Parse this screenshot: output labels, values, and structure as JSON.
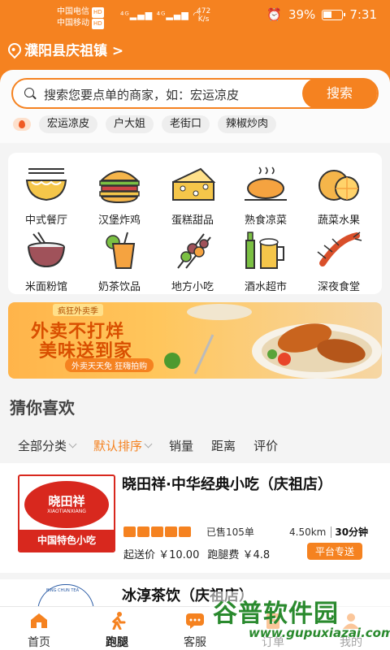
{
  "status_bar": {
    "carrier1": "中国电信",
    "carrier2": "中国移动",
    "hd": "HD",
    "speed": "472",
    "speed_unit": "K/s",
    "battery": "39%",
    "time": "7:31"
  },
  "location": {
    "text": "濮阳县庆祖镇 >"
  },
  "search": {
    "placeholder": "搜索您要点单的商家，如：宏运凉皮",
    "button": "搜索",
    "hot_tags": [
      "宏运凉皮",
      "户大姐",
      "老街口",
      "辣椒炒肉"
    ]
  },
  "categories": [
    {
      "label": "中式餐厅",
      "icon": "noodle-bowl-icon"
    },
    {
      "label": "汉堡炸鸡",
      "icon": "burger-icon"
    },
    {
      "label": "蛋糕甜品",
      "icon": "cheese-cake-icon"
    },
    {
      "label": "熟食凉菜",
      "icon": "roast-chicken-icon"
    },
    {
      "label": "蔬菜水果",
      "icon": "orange-icon"
    },
    {
      "label": "米面粉馆",
      "icon": "rice-bowl-icon"
    },
    {
      "label": "奶茶饮品",
      "icon": "milk-tea-icon"
    },
    {
      "label": "地方小吃",
      "icon": "skewers-icon"
    },
    {
      "label": "酒水超市",
      "icon": "beer-icon"
    },
    {
      "label": "深夜食堂",
      "icon": "lobster-icon"
    }
  ],
  "banner": {
    "tag": "疯狂外卖季",
    "line1": "外卖不打烊",
    "line2": "美味送到家",
    "line3": "外卖天天免 狂嗨拍购"
  },
  "section": {
    "title": "猜你喜欢"
  },
  "filters": [
    {
      "label": "全部分类",
      "caret": true,
      "active": false
    },
    {
      "label": "默认排序",
      "caret": true,
      "active": true
    },
    {
      "label": "销量",
      "caret": false,
      "active": false
    },
    {
      "label": "距离",
      "caret": false,
      "active": false
    },
    {
      "label": "评价",
      "caret": false,
      "active": false
    }
  ],
  "shop1": {
    "name": "晓田祥·中华经典小吃（庆祖店）",
    "logo_brand": "晓田祥",
    "logo_sub": "XIAOTIANXIANG",
    "logo_bottom": "中国特色小吃",
    "rating": 5,
    "sold": "已售105单",
    "distance": "4.50km",
    "eta": "30分钟",
    "min_order": "起送价 ￥10.00",
    "delivery_fee": "跑腿费 ￥4.8",
    "platform": "平台专送"
  },
  "shop2": {
    "name": "冰淳茶饮（庆祖店）",
    "logo_text": "BING CHUN TEA"
  },
  "nav": [
    {
      "label": "首页",
      "icon": "home-icon",
      "active": false
    },
    {
      "label": "跑腿",
      "icon": "runner-icon",
      "active": true
    },
    {
      "label": "客服",
      "icon": "chat-icon",
      "active": false
    },
    {
      "label": "订单",
      "icon": "order-icon",
      "active": false
    },
    {
      "label": "我的",
      "icon": "profile-icon",
      "active": false
    }
  ],
  "watermark": {
    "line1": "谷普软件园",
    "line2": "www.gupuxiazai.com"
  },
  "colors": {
    "accent": "#f58220",
    "brand_red": "#d8281e"
  }
}
